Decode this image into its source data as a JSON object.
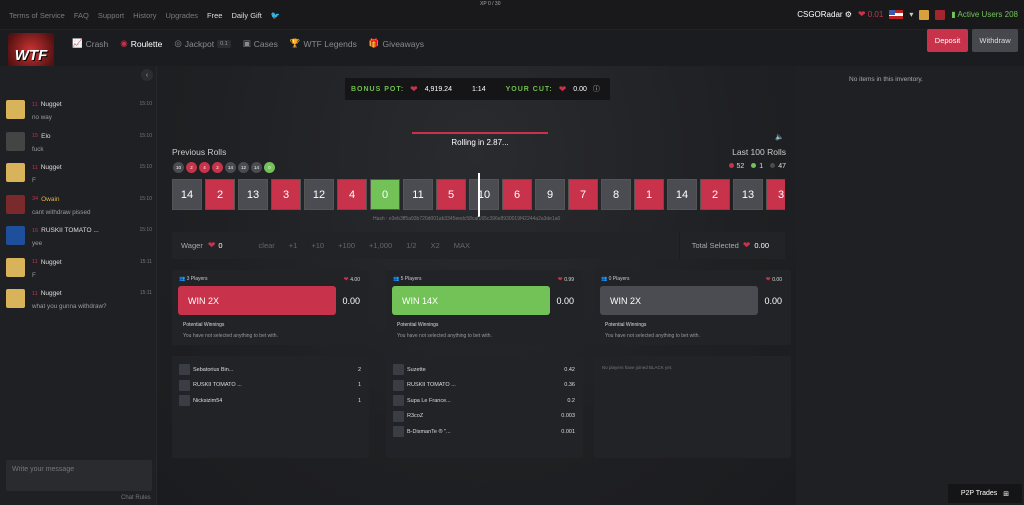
{
  "xp": "XP 0 / 30",
  "top_links": [
    "Terms of Service",
    "FAQ",
    "Support",
    "History",
    "Upgrades"
  ],
  "top_links_white": [
    "Free",
    "Daily Gift"
  ],
  "twitter_icon": "twitter-icon",
  "top_user": {
    "name": "CSGORadar",
    "balance": "0.01",
    "active_users": "Active Users 208"
  },
  "nav": [
    {
      "label": "Crash",
      "icon": "chart-icon",
      "active": false
    },
    {
      "label": "Roulette",
      "icon": "roulette-icon",
      "active": true
    },
    {
      "label": "Jackpot",
      "icon": "jackpot-icon",
      "active": false,
      "badge": "0.1"
    },
    {
      "label": "Cases",
      "icon": "case-icon",
      "active": false
    },
    {
      "label": "WTF Legends",
      "icon": "trophy-icon",
      "active": false
    },
    {
      "label": "Giveaways",
      "icon": "gift-icon",
      "active": false
    }
  ],
  "logo_text": "WTF",
  "buttons": {
    "deposit": "Deposit",
    "withdraw": "Withdraw"
  },
  "chat": {
    "messages": [
      {
        "lvl": "11",
        "name": "Nugget",
        "text": "no way",
        "time": "15:10",
        "av": "a1",
        "gold": false
      },
      {
        "lvl": "15",
        "name": "Elo",
        "text": "fuck",
        "time": "15:10",
        "av": "a2",
        "gold": false
      },
      {
        "lvl": "11",
        "name": "Nugget",
        "text": "F",
        "time": "15:10",
        "av": "a1",
        "gold": false
      },
      {
        "lvl": "34",
        "name": "Owain",
        "text": "cant withdraw pissed",
        "time": "15:10",
        "av": "a3",
        "gold": true
      },
      {
        "lvl": "16",
        "name": "RUSKII TOMATO ...",
        "text": "yee",
        "time": "15:10",
        "av": "a4",
        "gold": false
      },
      {
        "lvl": "11",
        "name": "Nugget",
        "text": "F",
        "time": "15:11",
        "av": "a1",
        "gold": false
      },
      {
        "lvl": "11",
        "name": "Nugget",
        "text": "what you gunna withdraw?",
        "time": "15:11",
        "av": "a1",
        "gold": false
      }
    ],
    "placeholder": "Write your message",
    "rules": "Chat Rules"
  },
  "bonus": {
    "label1": "BONUS POT:",
    "pot": "4,919.24",
    "ratio": "1:14",
    "label2": "YOUR CUT:",
    "cut": "0.00"
  },
  "rolling": {
    "text": "Rolling in 2.87...",
    "progress": 0.55
  },
  "previous_label": "Previous Rolls",
  "previous": [
    {
      "v": "10",
      "c": "black"
    },
    {
      "v": "2",
      "c": "red"
    },
    {
      "v": "4",
      "c": "red"
    },
    {
      "v": "2",
      "c": "red"
    },
    {
      "v": "14",
      "c": "black"
    },
    {
      "v": "12",
      "c": "black"
    },
    {
      "v": "14",
      "c": "black"
    },
    {
      "v": "0",
      "c": "green"
    }
  ],
  "last100": {
    "label": "Last 100 Rolls",
    "red": "52",
    "green": "1",
    "black": "47"
  },
  "strip": [
    {
      "v": "14",
      "c": "black"
    },
    {
      "v": "2",
      "c": "red"
    },
    {
      "v": "13",
      "c": "black"
    },
    {
      "v": "3",
      "c": "red"
    },
    {
      "v": "12",
      "c": "black"
    },
    {
      "v": "4",
      "c": "red"
    },
    {
      "v": "0",
      "c": "green"
    },
    {
      "v": "11",
      "c": "black"
    },
    {
      "v": "5",
      "c": "red"
    },
    {
      "v": "10",
      "c": "black"
    },
    {
      "v": "6",
      "c": "red"
    },
    {
      "v": "9",
      "c": "black"
    },
    {
      "v": "7",
      "c": "red"
    },
    {
      "v": "8",
      "c": "black"
    },
    {
      "v": "1",
      "c": "red"
    },
    {
      "v": "14",
      "c": "black"
    },
    {
      "v": "2",
      "c": "red"
    },
    {
      "v": "13",
      "c": "black"
    },
    {
      "v": "3",
      "c": "red"
    }
  ],
  "hash": "Hash : e3eb3ff5a93b720d001ab3345eedc58caf165c396e8930019f42244a2a3de1a0",
  "wager": {
    "label": "Wager",
    "value": "0",
    "options": [
      "clear",
      "+1",
      "+10",
      "+100",
      "+1,000",
      "1/2",
      "X2",
      "MAX"
    ],
    "total_label": "Total Selected",
    "total": "0.00"
  },
  "panels": [
    {
      "players": "3 Players",
      "pot": "4.00",
      "bet": "WIN 2X",
      "amount": "0.00",
      "color": "#c8324a",
      "pw": "Potential Winnings",
      "pwt": "You have not selected anything to bet with."
    },
    {
      "players": "5 Players",
      "pot": "0.99",
      "bet": "WIN 14X",
      "amount": "0.00",
      "color": "#72c257",
      "pw": "Potential Winnings",
      "pwt": "You have not selected anything to bet with."
    },
    {
      "players": "0 Players",
      "pot": "0.00",
      "bet": "WIN 2X",
      "amount": "0.00",
      "color": "#4a4c51",
      "pw": "Potential Winnings",
      "pwt": "You have not selected anything to bet with."
    }
  ],
  "lists": [
    {
      "rows": [
        {
          "name": "Sebatorius Bin...",
          "bet": "2"
        },
        {
          "name": "RUSKII TOMATO ...",
          "bet": "1"
        },
        {
          "name": "Nicksizim54",
          "bet": "1"
        }
      ]
    },
    {
      "rows": [
        {
          "name": "Suzette",
          "bet": "0.42"
        },
        {
          "name": "RUSKII TOMATO ...",
          "bet": "0.36"
        },
        {
          "name": "Supa Le France...",
          "bet": "0.2"
        },
        {
          "name": "R3coZ",
          "bet": "0.003"
        },
        {
          "name": "B-DismanTe ® \"...",
          "bet": "0.001"
        }
      ]
    },
    {
      "empty": "No players have joined BLACK yet."
    }
  ],
  "inventory": {
    "empty": "No items in this inventory.",
    "p2p": "P2P Trades"
  },
  "colors": {
    "red": "#c8324a",
    "green": "#72c257",
    "black": "#4a4c51"
  }
}
